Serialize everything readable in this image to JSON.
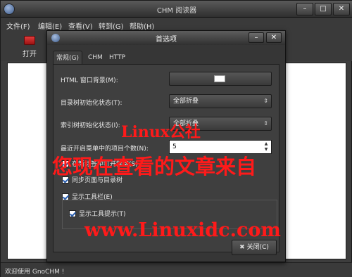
{
  "window": {
    "title": "CHM 阅读器",
    "minimize": "–",
    "maximize": "□",
    "close": "✕"
  },
  "menu": [
    "文件(F)",
    "编辑(E)",
    "查看(V)",
    "转到(G)",
    "帮助(H)"
  ],
  "toolbar": {
    "open_label": "打开"
  },
  "status": {
    "text": "欢迎使用 GnoCHM !"
  },
  "dialog": {
    "title": "首选项",
    "minimize": "–",
    "close": "✕",
    "tabs": [
      "常规(G)",
      "CHM",
      "HTTP"
    ],
    "active_tab": "常规(G)",
    "fields": {
      "html_bg_label": "HTML 窗口背景(M):",
      "html_bg_color": "#ffffff",
      "toc_state_label": "目录树初始化状态(T):",
      "toc_state_value": "全部折叠",
      "index_state_label": "索引树初始化状态(I):",
      "index_state_value": "全部折叠",
      "recent_label": "最近开启菜单中的项目个数(N):",
      "recent_value": "5"
    },
    "checks": {
      "open_in_new": {
        "label": "在新标签中打开链接(S)",
        "checked": true
      },
      "sync_tree": {
        "label": "同步页面与目录树",
        "checked": true
      },
      "show_toolbar": {
        "label": "显示工具栏(E)",
        "checked": true
      },
      "show_tooltips": {
        "label": "显示工具提示(T)",
        "checked": true
      }
    },
    "close_button": "关闭(C)"
  },
  "watermark": {
    "line1": "Linux公社",
    "line2": "您现在查看的文章来自",
    "line3": "www.Linuxidc.com",
    "color": "#ff1a1a"
  }
}
